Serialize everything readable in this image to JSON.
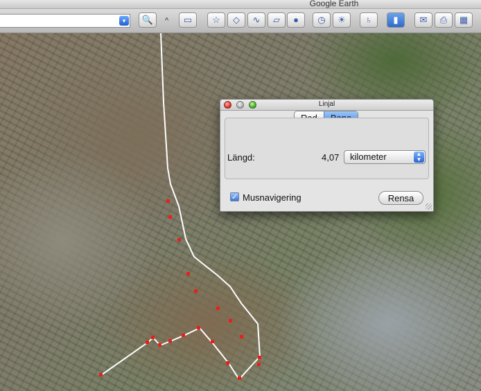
{
  "window": {
    "title": "Google Earth"
  },
  "toolbar": {
    "search_dropdown_icon": "dropdown-arrow-icon",
    "collapse_caret": "^",
    "buttons": [
      {
        "icon": "search-icon",
        "glyph": "🔍"
      },
      {
        "icon": "sidebar-icon",
        "glyph": "▭"
      },
      {
        "icon": "placemark-icon",
        "glyph": "☆"
      },
      {
        "icon": "polygon-icon",
        "glyph": "◇"
      },
      {
        "icon": "path-icon",
        "glyph": "∿"
      },
      {
        "icon": "image-overlay-icon",
        "glyph": "▱"
      },
      {
        "icon": "record-tour-icon",
        "glyph": "●"
      },
      {
        "icon": "historical-imagery-icon",
        "glyph": "◷"
      },
      {
        "icon": "sunlight-icon",
        "glyph": "☀"
      },
      {
        "icon": "planets-icon",
        "glyph": "♄"
      },
      {
        "icon": "ruler-icon",
        "glyph": "▮"
      },
      {
        "icon": "email-icon",
        "glyph": "✉"
      },
      {
        "icon": "print-icon",
        "glyph": "⎙"
      },
      {
        "icon": "view-in-maps-icon",
        "glyph": "▦"
      }
    ]
  },
  "ruler": {
    "title": "Linjal",
    "tabs": [
      "Rad",
      "Bana"
    ],
    "active_tab": "Bana",
    "length_label": "Längd:",
    "length_value": "4,07",
    "unit": "kilometer",
    "mouse_nav_label": "Musnavigering",
    "mouse_nav_checked": true,
    "clear_label": "Rensa"
  },
  "map": {
    "path_color": "#ffffff",
    "point_color": "#e8201a"
  }
}
